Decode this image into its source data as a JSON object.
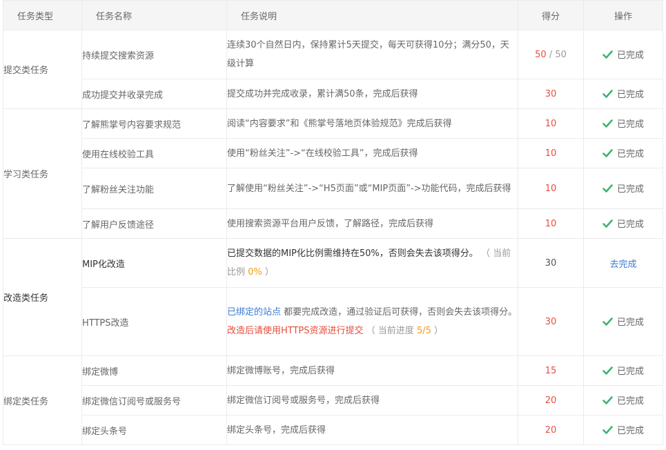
{
  "header": {
    "type": "任务类型",
    "name": "任务名称",
    "desc": "任务说明",
    "score": "得分",
    "op": "操作"
  },
  "groups": [
    {
      "type": "提交类任务",
      "rows": [
        {
          "name": "持续提交搜索资源",
          "desc": "连续30个自然日内，保持累计5天提交，每天可获得10分；满分50，天级计算",
          "score": "50",
          "score_total": "50",
          "status": "已完成"
        },
        {
          "name": "成功提交并收录完成",
          "desc": "提交成功并完成收录，累计满50条，完成后获得",
          "score": "30",
          "status": "已完成"
        }
      ]
    },
    {
      "type": "学习类任务",
      "rows": [
        {
          "name": "了解熊掌号内容要求规范",
          "desc": "阅读“内容要求”和《熊掌号落地页体验规范》完成后获得",
          "score": "10",
          "status": "已完成"
        },
        {
          "name": "使用在线校验工具",
          "desc": "使用“粉丝关注”->“在线校验工具”，完成后获得",
          "score": "10",
          "status": "已完成"
        },
        {
          "name": "了解粉丝关注功能",
          "desc": "了解使用“粉丝关注”->“H5页面”或“MIP页面”->功能代码，完成后获得",
          "score": "10",
          "status": "已完成"
        },
        {
          "name": "了解用户反馈途径",
          "desc": "使用搜索资源平台用户反馈，了解路径，完成后获得",
          "score": "10",
          "status": "已完成"
        }
      ]
    },
    {
      "type": "改造类任务",
      "rows": [
        {
          "name": "MIP化改造",
          "desc": "已提交数据的MIP化比例需维持在50%，否则会失去该项得分。",
          "desc_paren_open": "（ 当前比例",
          "desc_value": "0%",
          "desc_paren_close": "）",
          "score": "30",
          "action": "去完成"
        },
        {
          "name": "HTTPS改造",
          "desc_link": "已绑定的站点",
          "desc": "都要完成改造，通过验证后可获得，否则会失去该项得分。",
          "desc_warn": "改造后请使用HTTPS资源进行提交",
          "desc_paren_open": "（ 当前进度",
          "desc_value": "5/5",
          "desc_paren_close": "）",
          "score": "30",
          "status": "已完成"
        }
      ]
    },
    {
      "type": "绑定类任务",
      "rows": [
        {
          "name": "绑定微博",
          "desc": "绑定微博账号，完成后获得",
          "score": "15",
          "status": "已完成"
        },
        {
          "name": "绑定微信订阅号或服务号",
          "desc": "绑定微信订阅号或服务号，完成后获得",
          "score": "20",
          "status": "已完成"
        },
        {
          "name": "绑定头条号",
          "desc": "绑定头条号，完成后获得",
          "score": "20",
          "status": "已完成"
        }
      ]
    }
  ],
  "score_separator": "/",
  "icons": {
    "done": "check-icon"
  },
  "colors": {
    "score_red": "#e74c3c",
    "check_green": "#3cb371",
    "link_blue": "#3a7bd5",
    "orange": "#f39c12"
  }
}
